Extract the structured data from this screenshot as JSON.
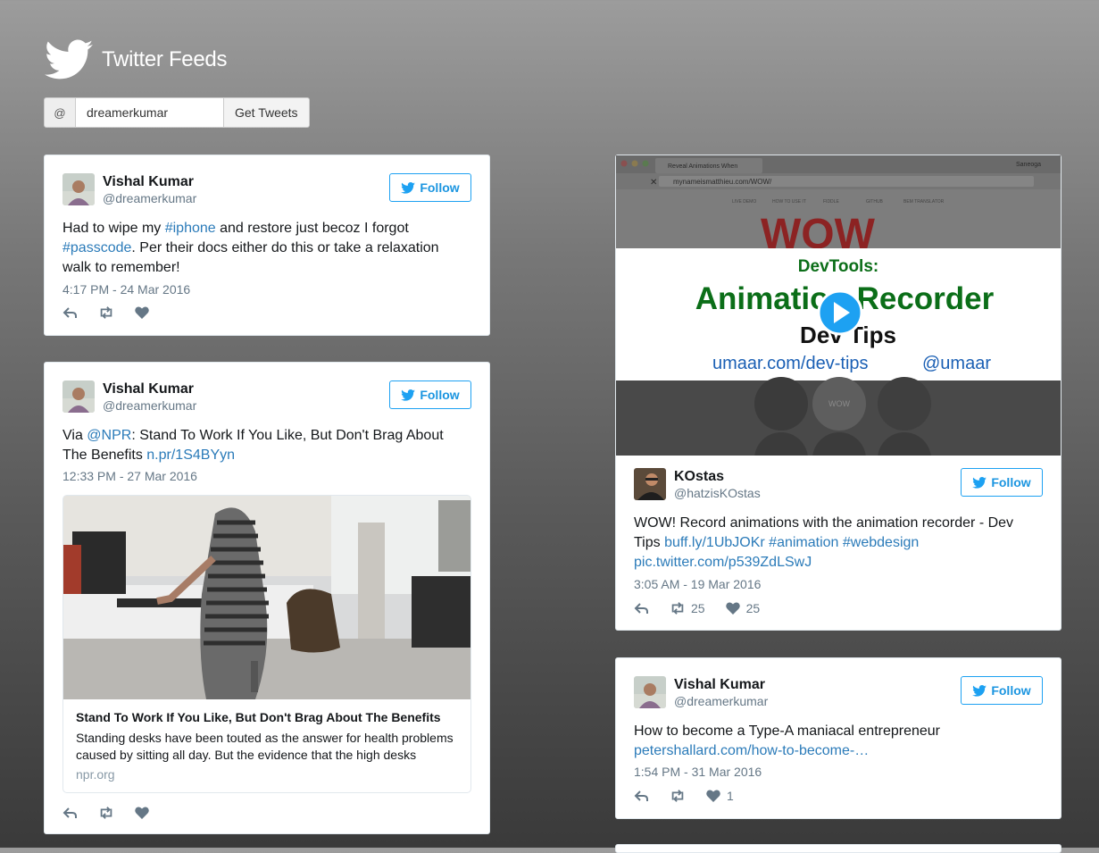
{
  "header": {
    "title": "Twitter Feeds",
    "icon": "twitter-bird-icon"
  },
  "search": {
    "prefix": "@",
    "value": "dreamerkumar",
    "button_label": "Get Tweets"
  },
  "follow_label": "Follow",
  "tweets": [
    {
      "name": "Vishal Kumar",
      "handle": "@dreamerkumar",
      "text_parts": [
        "Had to wipe my ",
        "#iphone",
        " and restore just becoz I forgot ",
        "#passcode",
        ". Per their docs either do this or take a relaxation walk to remember!"
      ],
      "time": "4:17 PM - 24 Mar 2016"
    },
    {
      "name": "Vishal Kumar",
      "handle": "@dreamerkumar",
      "text_parts": [
        "Via ",
        "@NPR",
        ": Stand To Work If You Like, But Don't Brag About The Benefits ",
        "n.pr/1S4BYyn"
      ],
      "time": "12:33 PM - 27 Mar 2016",
      "card": {
        "title": "Stand To Work If You Like, But Don't Brag About The Benefits",
        "description": "Standing desks have been touted as the answer for health problems caused by sitting all day. But the evidence that the high desks",
        "host": "npr.org"
      }
    },
    {
      "name": "KOstas",
      "handle": "@hatzisKOstas",
      "text_parts": [
        "WOW! Record animations with the animation recorder - Dev Tips ",
        "buff.ly/1UbJOKr",
        " ",
        "#animation",
        " ",
        "#webdesign",
        " ",
        "pic.twitter.com/p539ZdLSwJ"
      ],
      "time": "3:05 AM - 19 Mar 2016",
      "retweets": "25",
      "likes": "25",
      "video": {
        "tab_title": "Reveal Animations When",
        "url": "mynameismatthieu.com/WOW/",
        "browser_user": "Saneoga",
        "nav_items": [
          "LIVE DEMO",
          "HOW TO USE IT",
          "FIDDLE",
          "GITHUB",
          "BEM TRANSLATOR"
        ],
        "logo_text": "WOW",
        "banner_line1": "DevTools:",
        "banner_line2": "Animation Recorder",
        "banner_line3": "Dev Tips",
        "banner_link1": "umaar.com/dev-tips",
        "banner_link2": "@umaar",
        "circle_label": "WOW"
      }
    },
    {
      "name": "Vishal Kumar",
      "handle": "@dreamerkumar",
      "text_parts": [
        "How to become a Type-A maniacal entrepreneur ",
        "petershallard.com/how-to-become-…"
      ],
      "time": "1:54 PM - 31 Mar 2016",
      "likes": "1"
    }
  ],
  "colors": {
    "link": "#2b7bb9",
    "accent": "#1da1f2",
    "muted": "#657786",
    "banner_green": "#0b6e18",
    "banner_blue": "#1a5fb4"
  }
}
